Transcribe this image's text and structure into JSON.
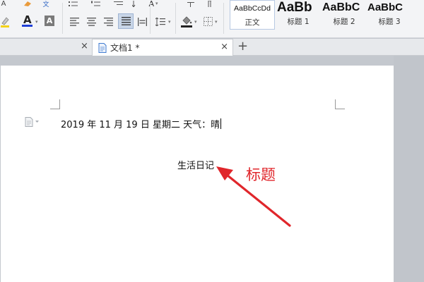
{
  "toolbar": {
    "language_glyph": "文",
    "font_color_glyph": "A",
    "text_effect_glyph": "A",
    "font_size_glyph": "A",
    "font_color_value": "#1f3fd6",
    "highlight_value": "#f4d21a"
  },
  "styles": [
    {
      "sample": "AaBbCcDd",
      "label": "正文"
    },
    {
      "sample": "AaBb",
      "label": "标题 1"
    },
    {
      "sample": "AaBbC",
      "label": "标题 2"
    },
    {
      "sample": "AaBbC",
      "label": "标题 3"
    }
  ],
  "tabs": {
    "active_label": "文档1 *",
    "new_tab_glyph": "+",
    "close_glyph": "×"
  },
  "document": {
    "line1": "2019 年 11 月 19 日   星期二  天气：晴",
    "title": "生活日记"
  },
  "annotation": {
    "label": "标题",
    "color": "#e0262b"
  }
}
